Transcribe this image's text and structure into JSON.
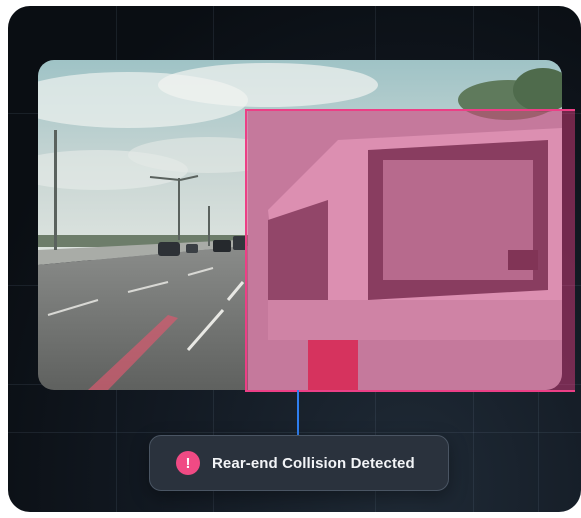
{
  "alert": {
    "icon": "exclamation-circle-icon",
    "icon_glyph": "!",
    "label": "Rear-end Collision Detected"
  },
  "colors": {
    "detection_box": "#ec3f86",
    "alert_icon": "#f04a84",
    "connector": "#2f7ff0",
    "card_background": "#0a0e13"
  }
}
